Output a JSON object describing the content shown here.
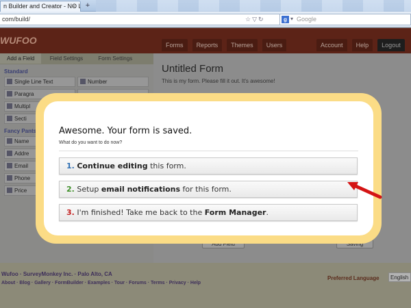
{
  "browser": {
    "tab_title": "n Builder and Creator - NO L...",
    "tab_close": "×",
    "new_tab": "+",
    "url": "com/build/",
    "search_placeholder": "Google",
    "search_engine_icon": "google-g-icon",
    "search_engine_letter": "g"
  },
  "app": {
    "logo": "WUFOO",
    "nav": [
      "Forms",
      "Reports",
      "Themes",
      "Users"
    ],
    "account": "Account",
    "help": "Help",
    "logout": "Logout",
    "sidebar_tabs": [
      "Add a Field",
      "Field Settings",
      "Form Settings"
    ],
    "standard_label": "Standard",
    "standard_fields": [
      "Single Line Text",
      "Number",
      "Paragra",
      "",
      "Multipl",
      "",
      "Secti",
      ""
    ],
    "fancy_label": "Fancy Pants",
    "fancy_fields": [
      "Name",
      "",
      "Addre",
      "",
      "Email",
      "",
      "Phone",
      "",
      "Price",
      ""
    ],
    "form_title": "Untitled Form",
    "form_description": "This is my form. Please fill it out. It's awesome!",
    "add_field_button": "Add Field",
    "saving_button": "Saving",
    "footer_company": "Wufoo · SurveyMonkey Inc. · Palo Alto, CA",
    "footer_links": "About · Blog · Gallery · FormBuilder · Examples · Tour · Forums · Terms · Privacy · Help",
    "preferred_language_label": "Preferred Language",
    "language_value": "English"
  },
  "modal": {
    "title": "Awesome. Your form is saved.",
    "subtitle": "What do you want to do now?",
    "options": [
      {
        "num": "1.",
        "before": " ",
        "bold": "Continue editing",
        "after": " this form."
      },
      {
        "num": "2.",
        "before": " Setup ",
        "bold": "email notifications",
        "after": " for this form."
      },
      {
        "num": "3.",
        "before": " I'm finished! Take me back to the ",
        "bold": "Form Manager",
        "after": "."
      }
    ],
    "frame_color": "#fbdc86",
    "arrow_color": "#d41414"
  }
}
